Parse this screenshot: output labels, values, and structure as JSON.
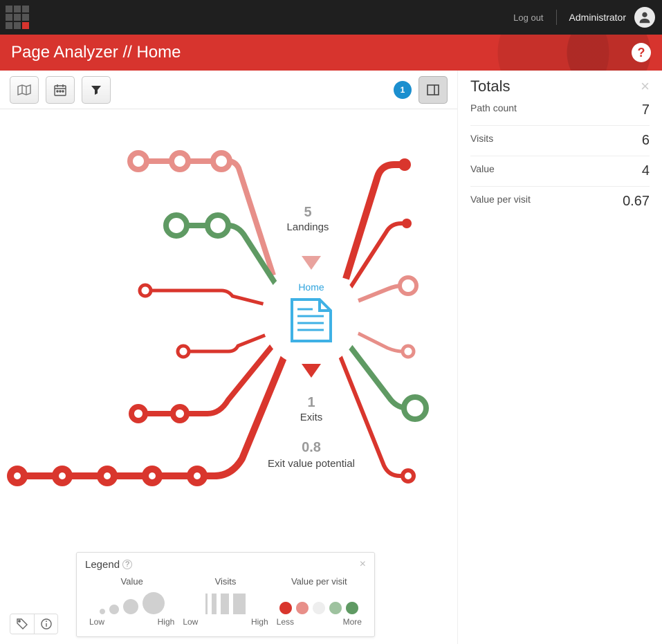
{
  "header": {
    "logout": "Log out",
    "username": "Administrator",
    "title": "Page Analyzer // Home",
    "badge": "1"
  },
  "diagram": {
    "node_name": "Home",
    "landings_value": "5",
    "landings_label": "Landings",
    "exits_value": "1",
    "exits_label": "Exits",
    "evp_value": "0.8",
    "evp_label": "Exit value potential"
  },
  "legend": {
    "title": "Legend",
    "col1_title": "Value",
    "col2_title": "Visits",
    "col3_title": "Value per visit",
    "low": "Low",
    "high": "High",
    "less": "Less",
    "more": "More"
  },
  "totals": {
    "title": "Totals",
    "rows": [
      {
        "label": "Path count",
        "value": "7"
      },
      {
        "label": "Visits",
        "value": "6"
      },
      {
        "label": "Value",
        "value": "4"
      },
      {
        "label": "Value per visit",
        "value": "0.67"
      }
    ]
  }
}
